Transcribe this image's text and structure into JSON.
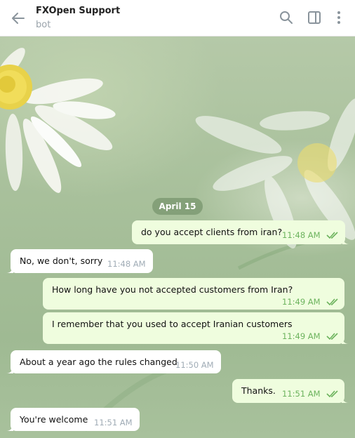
{
  "header": {
    "title": "FXOpen Support",
    "subtitle": "bot"
  },
  "icons": {
    "back": "arrow-left-icon",
    "search": "search-icon",
    "panel": "sidebar-toggle-icon",
    "menu": "more-vertical-icon",
    "read": "double-check-icon"
  },
  "colors": {
    "outgoing_bubble": "#effdde",
    "incoming_bubble": "#ffffff",
    "outgoing_time": "#6cb35d",
    "incoming_time": "#a0acb6"
  },
  "chat": {
    "date": "April 15",
    "messages": [
      {
        "direction": "out",
        "text": "do you accept clients from iran?",
        "time": "11:48 AM",
        "read": true
      },
      {
        "direction": "in",
        "text": "No, we don't, sorry",
        "time": "11:48 AM"
      },
      {
        "direction": "out",
        "text": "How long have you not accepted customers from Iran?",
        "time": "11:49 AM",
        "read": true
      },
      {
        "direction": "out",
        "text": "I remember that you used to accept Iranian customers",
        "time": "11:49 AM",
        "read": true
      },
      {
        "direction": "in",
        "text": "About a year ago the rules changed",
        "time": "11:50 AM"
      },
      {
        "direction": "out",
        "text": "Thanks.",
        "time": "11:51 AM",
        "read": true
      },
      {
        "direction": "in",
        "text": "You're welcome",
        "time": "11:51 AM"
      }
    ]
  }
}
